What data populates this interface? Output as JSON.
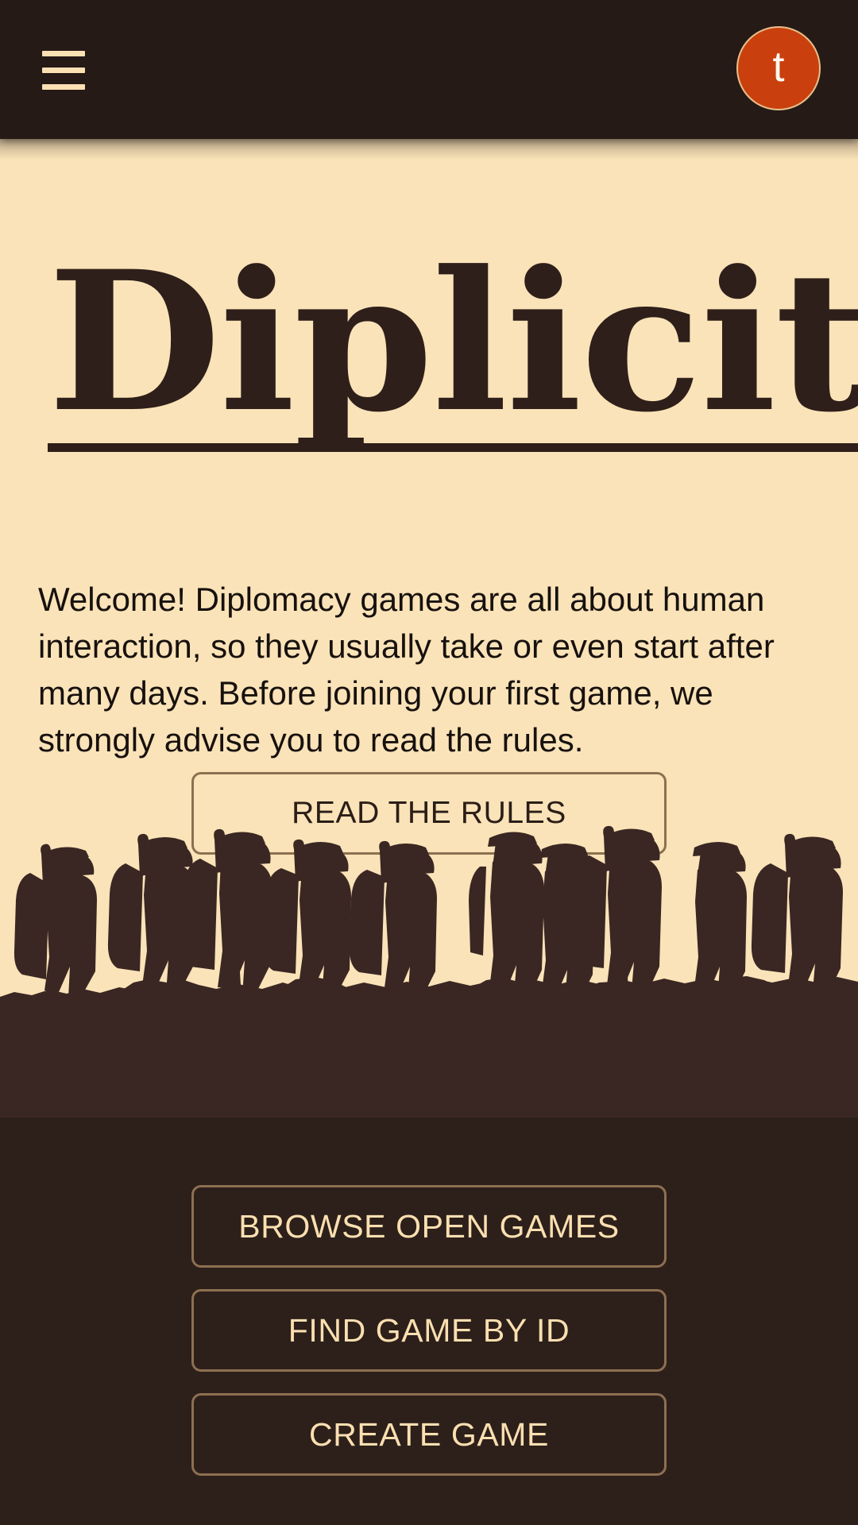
{
  "colors": {
    "app_bar_bg": "#261a17",
    "hero_bg": "#fae3b8",
    "dark_bg": "#2d201b",
    "silhouette": "#3a2723",
    "accent_orange": "#c9400e",
    "border_tan": "#8d7050",
    "cream_text": "#fbdfb0",
    "dark_text": "#17110e"
  },
  "appbar": {
    "menu_icon": "hamburger-menu-icon",
    "menu_label": "Menu",
    "avatar": {
      "icon": "user-avatar",
      "initial": "t"
    }
  },
  "hero": {
    "title": "Diplicity",
    "intro": "Welcome! Diplomacy games are all about human interaction, so they usually take or even start after many days. Before joining your first game, we strongly advise you to read the rules.",
    "read_rules_button": "READ THE RULES",
    "illustration": "marching-soldiers-silhouette"
  },
  "footer": {
    "buttons": [
      {
        "label": "BROWSE OPEN GAMES",
        "name": "browse-open-games-button"
      },
      {
        "label": "FIND GAME BY ID",
        "name": "find-game-by-id-button"
      },
      {
        "label": "CREATE GAME",
        "name": "create-game-button"
      }
    ]
  }
}
